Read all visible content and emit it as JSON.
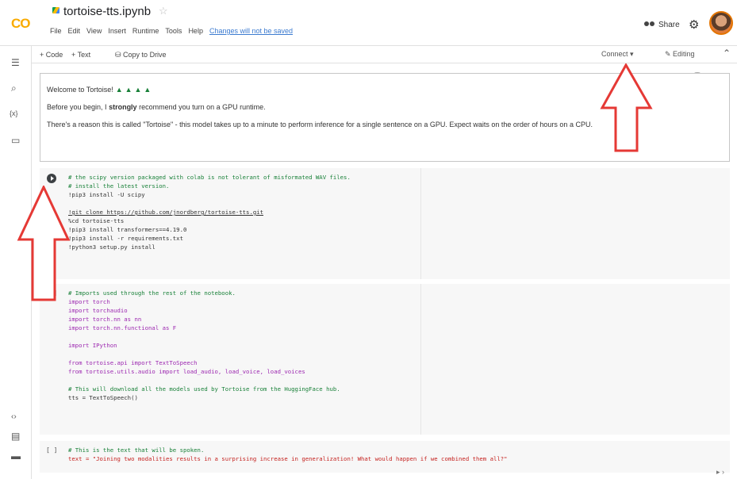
{
  "header": {
    "logo": "CO",
    "title": "tortoise-tts.ipynb",
    "menus": [
      "File",
      "Edit",
      "View",
      "Insert",
      "Runtime",
      "Tools",
      "Help"
    ],
    "changes": "Changes will not be saved",
    "share": "Share"
  },
  "toolbar": {
    "code": "+ Code",
    "text": "+ Text",
    "copy": "Copy to Drive",
    "connect": "Connect",
    "editing": "Editing"
  },
  "text_cell": {
    "welcome": "Welcome to Tortoise!",
    "line1_pre": "Before you begin, I ",
    "line1_bold": "strongly",
    "line1_post": " recommend you turn on a GPU runtime.",
    "line2": "There's a reason this is called \"Tortoise\" - this model takes up to a minute to perform inference for a single sentence on a GPU. Expect waits on the order of hours on a CPU."
  },
  "cells": [
    {
      "lines": [
        "# the scipy version packaged with colab is not tolerant of misformated WAV files.",
        "# install the latest version.",
        "!pip3 install -U scipy",
        "",
        "!git clone https://github.com/jnordberg/tortoise-tts.git",
        "%cd tortoise-tts",
        "!pip3 install transformers==4.19.0",
        "!pip3 install -r requirements.txt",
        "!python3 setup.py install"
      ]
    },
    {
      "lines": [
        "# Imports used through the rest of the notebook.",
        "import torch",
        "import torchaudio",
        "import torch.nn as nn",
        "import torch.nn.functional as F",
        "",
        "import IPython",
        "",
        "from tortoise.api import TextToSpeech",
        "from tortoise.utils.audio import load_audio, load_voice, load_voices",
        "",
        "# This will download all the models used by Tortoise from the HuggingFace hub.",
        "tts = TextToSpeech()"
      ]
    },
    {
      "lines": [
        "# This is the text that will be spoken.",
        "text = \"Joining two modalities results in a surprising increase in generalization! What would happen if we combined them all?\""
      ]
    }
  ],
  "brackets": "[ ]",
  "annotation_color": "#e53935"
}
